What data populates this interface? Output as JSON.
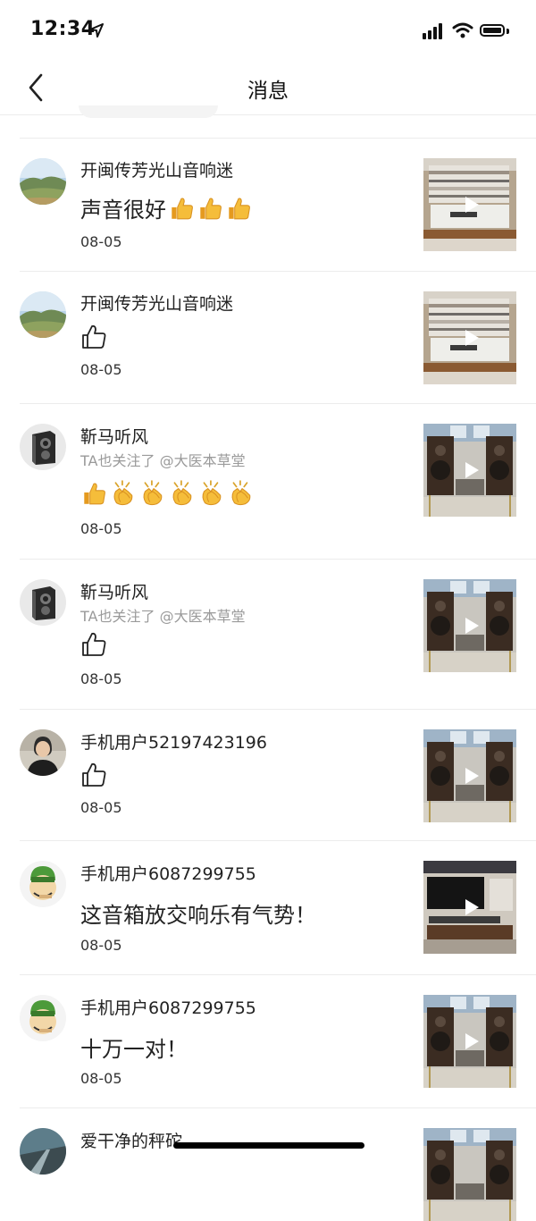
{
  "status_bar": {
    "time": "12:34"
  },
  "nav": {
    "title": "消息"
  },
  "rows": [
    {
      "name": "开闽传芳光山音响迷",
      "message": "声音很好",
      "message_emojis": [
        "thumbs-up",
        "thumbs-up",
        "thumbs-up"
      ],
      "date": "08-05"
    },
    {
      "name": "开闽传芳光山音响迷",
      "message_icon": "like-icon",
      "date": "08-05"
    },
    {
      "name": "靳马听风",
      "subtitle": "TA也关注了 @大医本草堂",
      "message_emojis": [
        "thumbs-up",
        "clapping-hands",
        "clapping-hands",
        "clapping-hands",
        "clapping-hands",
        "clapping-hands"
      ],
      "date": "08-05"
    },
    {
      "name": "靳马听风",
      "subtitle": "TA也关注了 @大医本草堂",
      "message_icon": "like-icon",
      "date": "08-05"
    },
    {
      "name": "手机用户52197423196",
      "message_icon": "like-icon",
      "date": "08-05"
    },
    {
      "name": "手机用户6087299755",
      "message": "这音箱放交响乐有气势！",
      "date": "08-05"
    },
    {
      "name": "手机用户6087299755",
      "message": "十万一对！",
      "date": "08-05"
    },
    {
      "name": "爱干净的秤砣"
    }
  ],
  "colors": {
    "divider": "#ececec",
    "secondary_text": "#9a9a9a",
    "thumb_emoji": "#f2b632"
  }
}
